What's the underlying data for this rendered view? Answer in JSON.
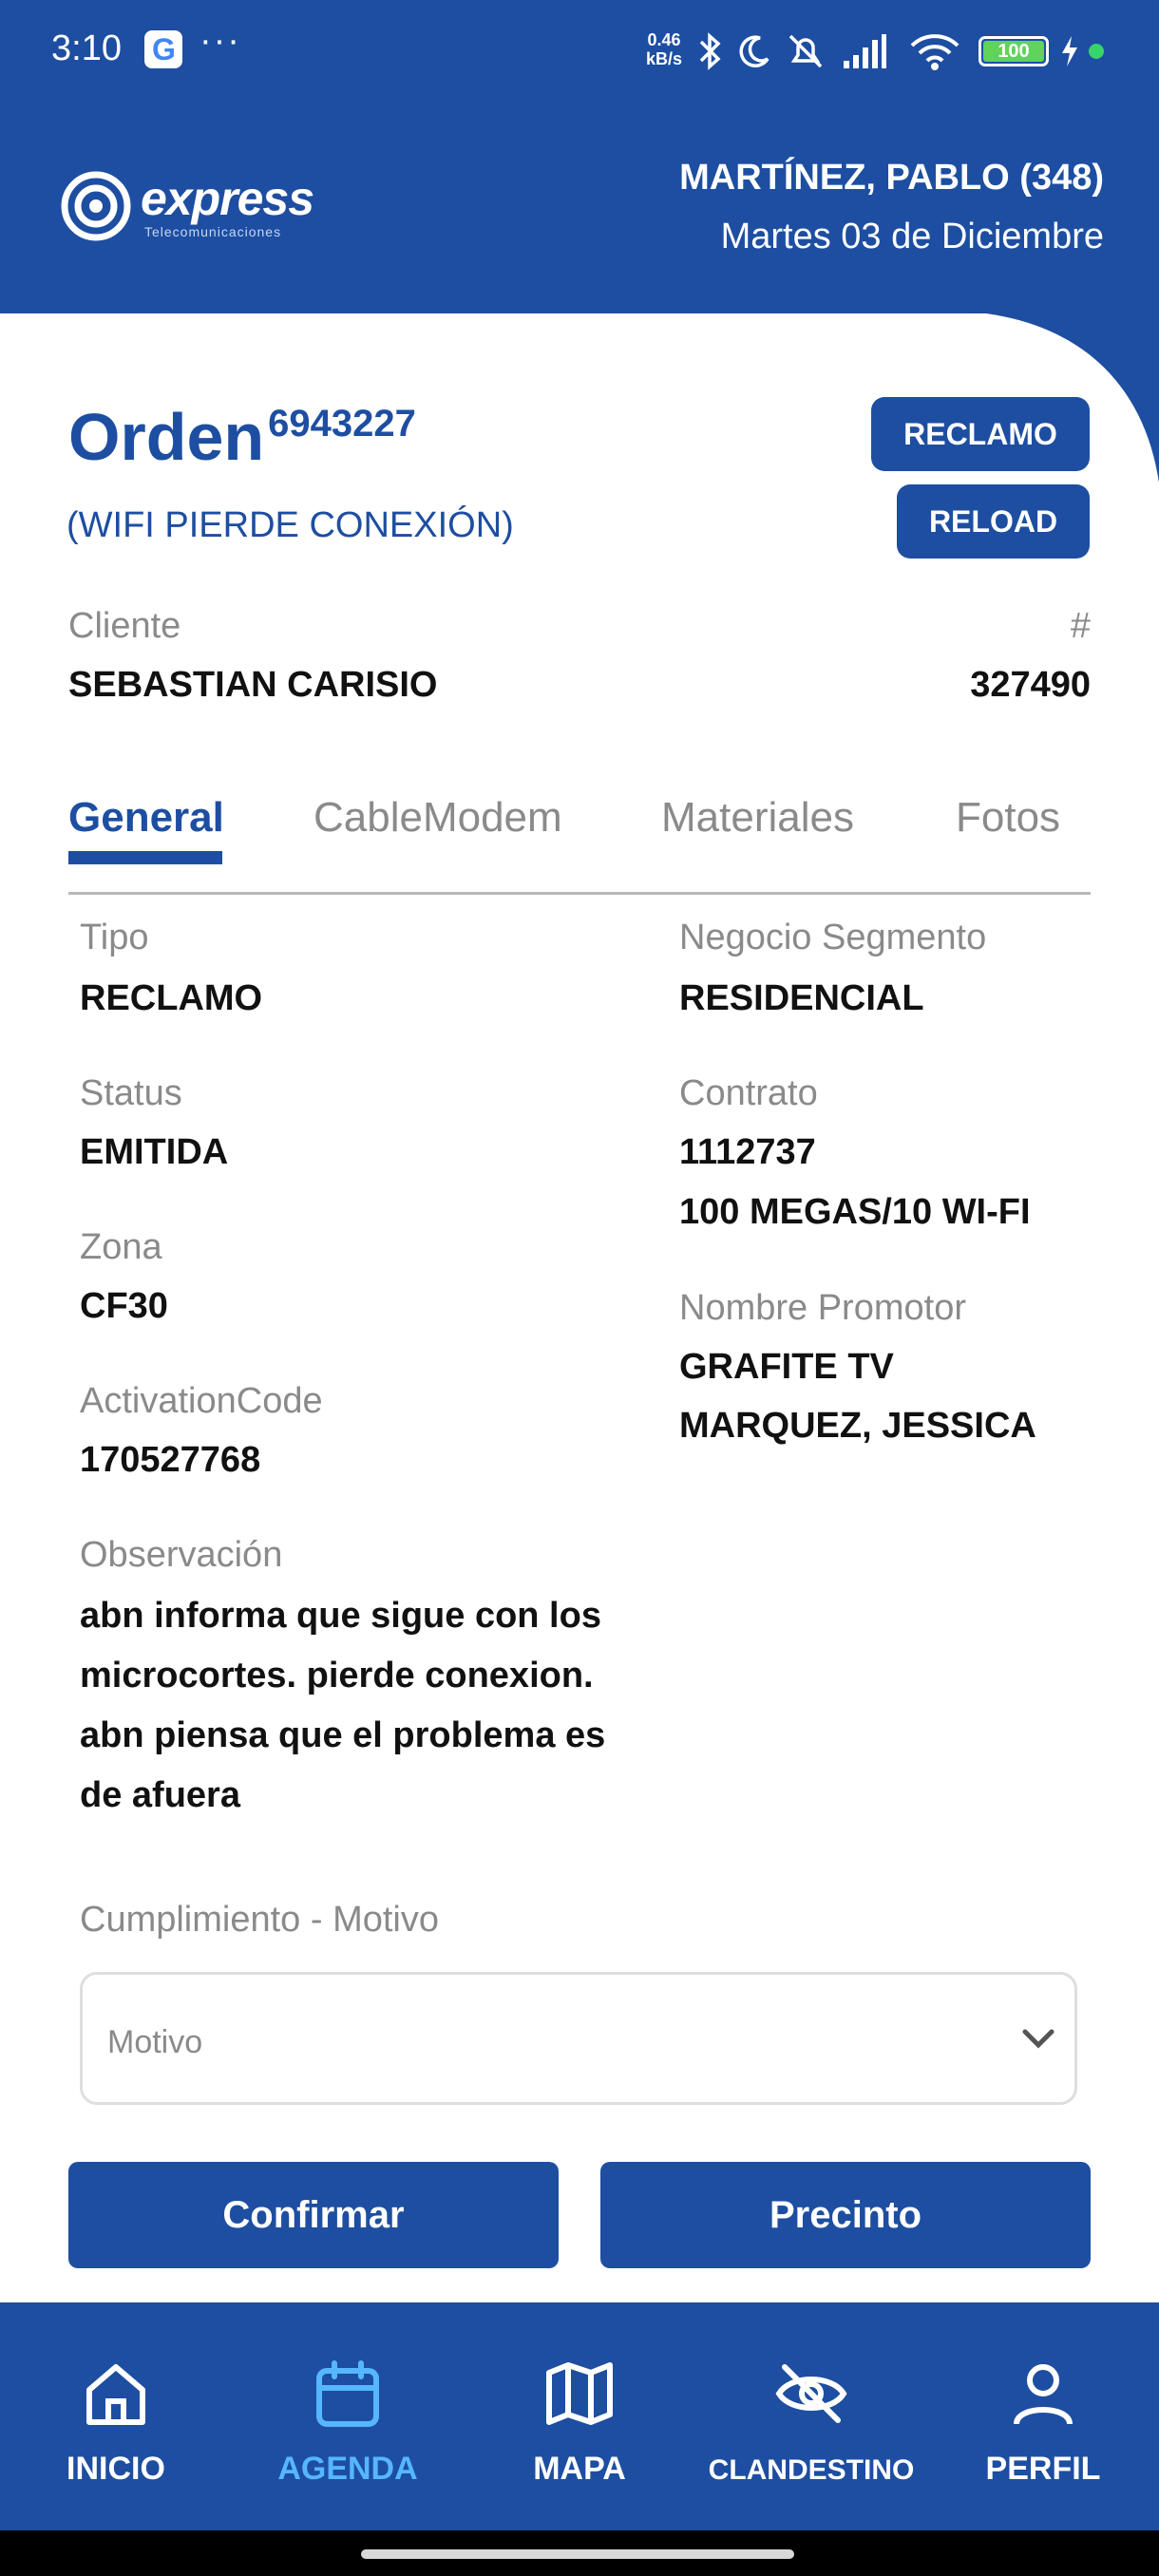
{
  "status_bar": {
    "time": "3:10",
    "notification_dots": "···",
    "net_speed_value": "0.46",
    "net_speed_unit": "kB/s",
    "battery": "100"
  },
  "header": {
    "logo_text": "express",
    "logo_sub": "Telecomunicaciones",
    "tech_name": "MARTÍNEZ, PABLO (348)",
    "date": "Martes 03 de Diciembre"
  },
  "order": {
    "word": "Orden",
    "number": "6943227",
    "subtitle": "(WIFI PIERDE CONEXIÓN)",
    "btn_reclamo": "RECLAMO",
    "btn_reload": "RELOAD"
  },
  "client": {
    "label": "Cliente",
    "name": "SEBASTIAN CARISIO",
    "hash_label": "#",
    "number": "327490"
  },
  "tabs": [
    "General",
    "CableModem",
    "Materiales",
    "Fotos"
  ],
  "details": {
    "tipo_label": "Tipo",
    "tipo_value": "RECLAMO",
    "status_label": "Status",
    "status_value": "EMITIDA",
    "zona_label": "Zona",
    "zona_value": "CF30",
    "activation_label": "ActivationCode",
    "activation_value": "170527768",
    "obs_label": "Observación",
    "obs_value": "abn informa que sigue con los microcortes. pierde conexion. abn piensa que el problema es de afuera",
    "negocio_label": "Negocio Segmento",
    "negocio_value": "RESIDENCIAL",
    "contrato_label": "Contrato",
    "contrato_value_1": "1112737",
    "contrato_value_2": "100 MEGAS/10 WI-FI",
    "promotor_label": "Nombre Promotor",
    "promotor_value_1": "GRAFITE TV",
    "promotor_value_2": "MARQUEZ, JESSICA"
  },
  "cumplimiento": {
    "label": "Cumplimiento - Motivo",
    "placeholder": "Motivo"
  },
  "actions": {
    "confirm": "Confirmar",
    "precinto": "Precinto"
  },
  "nav": [
    {
      "label": "INICIO",
      "icon": "home-icon"
    },
    {
      "label": "AGENDA",
      "icon": "calendar-icon"
    },
    {
      "label": "MAPA",
      "icon": "map-icon"
    },
    {
      "label": "CLANDESTINO",
      "icon": "eye-off-icon"
    },
    {
      "label": "PERFIL",
      "icon": "user-icon"
    }
  ],
  "colors": {
    "primary": "#1d4ea1",
    "active_nav": "#56b6ff"
  }
}
